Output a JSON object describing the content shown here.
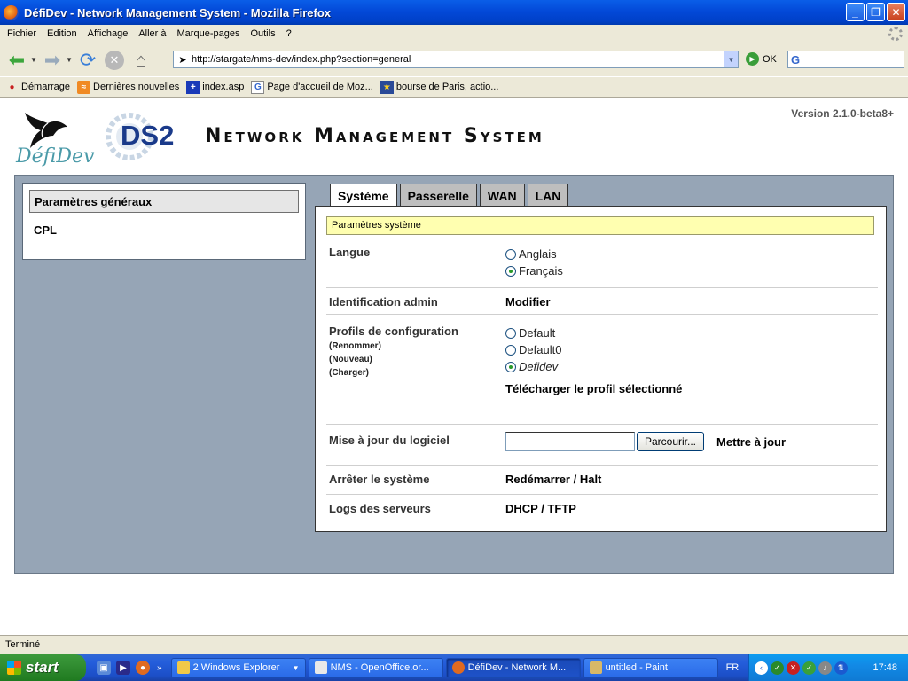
{
  "window": {
    "title": "DéfiDev - Network Management System - Mozilla Firefox",
    "min_glyph": "_",
    "max_glyph": "❐",
    "close_glyph": "✕"
  },
  "menu": [
    "Fichier",
    "Edition",
    "Affichage",
    "Aller à",
    "Marque-pages",
    "Outils",
    "?"
  ],
  "navbar": {
    "url": "http://stargate/nms-dev/index.php?section=general",
    "go_label": "OK",
    "search_placeholder": ""
  },
  "bookmarks": [
    "Démarrage",
    "Dernières nouvelles",
    "index.asp",
    "Page d'accueil de Moz...",
    "bourse de Paris, actio..."
  ],
  "page": {
    "version": "Version 2.1.0-beta8+",
    "logo_text": "DéfiDev",
    "ds2_text": "DS2",
    "app_title": "Network Management System",
    "side_menu": [
      "Paramètres généraux",
      "CPL"
    ],
    "tabs": [
      "Système",
      "Passerelle",
      "WAN",
      "LAN"
    ],
    "section_title": "Paramètres système",
    "langue": {
      "label": "Langue",
      "options": [
        "Anglais",
        "Français"
      ],
      "selected": "Français"
    },
    "admin": {
      "label": "Identification admin",
      "action": "Modifier"
    },
    "profils": {
      "label": "Profils de configuration",
      "subactions": [
        "(Renommer)",
        "(Nouveau)",
        "(Charger)"
      ],
      "options": [
        "Default",
        "Default0",
        "Defidev"
      ],
      "selected": "Defidev",
      "download": "Télécharger le profil sélectionné"
    },
    "update": {
      "label": "Mise à jour du logiciel",
      "file_value": "",
      "browse": "Parcourir...",
      "action": "Mettre à jour"
    },
    "shutdown": {
      "label": "Arrêter le système",
      "action": "Redémarrer / Halt"
    },
    "logs": {
      "label": "Logs des serveurs",
      "action": "DHCP / TFTP"
    }
  },
  "status": "Terminé",
  "taskbar": {
    "start": "start",
    "tasks": [
      "2 Windows Explorer",
      "NMS - OpenOffice.or...",
      "DéfiDev - Network M...",
      "untitled - Paint"
    ],
    "active_task": "DéfiDev - Network M...",
    "lang": "FR",
    "clock": "17:48"
  },
  "colors": {
    "panel_bg": "#96a5b6",
    "section_highlight": "#ffffb0",
    "titlebar": "#0349d8",
    "taskbar": "#245edb"
  }
}
